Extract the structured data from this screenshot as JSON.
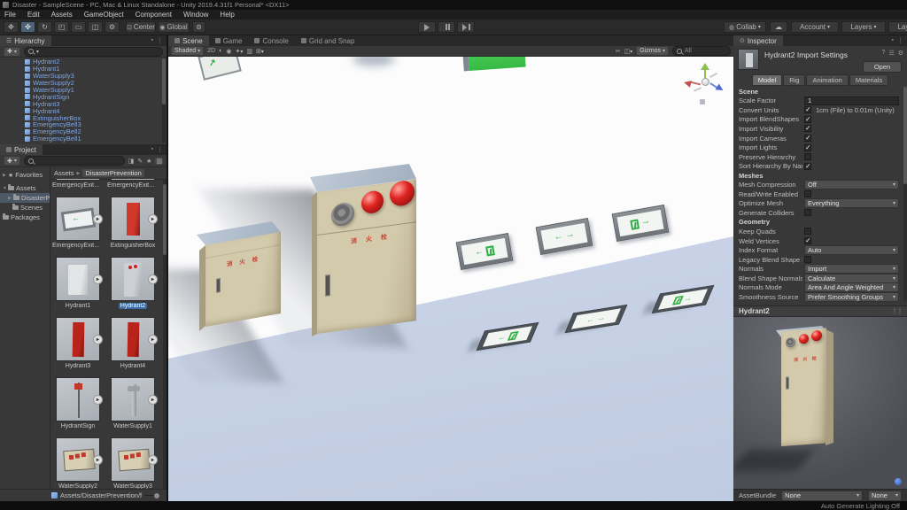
{
  "window": {
    "title": "Disaster - SampleScene - PC, Mac & Linux Standalone - Unity 2019.4.31f1 Personal* <DX11>",
    "menus": [
      "File",
      "Edit",
      "Assets",
      "GameObject",
      "Component",
      "Window",
      "Help"
    ]
  },
  "toolbar": {
    "center": "Center",
    "global": "Global",
    "collab": "Collab",
    "account": "Account",
    "layers": "Layers",
    "layout": "Layout"
  },
  "icons": {
    "unity-logo": "cube",
    "hand-tool": "✥",
    "move-tool": "✜",
    "rotate-tool": "↻",
    "scale-tool": "◰",
    "rect-tool": "▭",
    "transform-tool": "◫",
    "custom-tool": "⚙",
    "cloud-icon": "☁",
    "play-icon": "triangle",
    "pause-icon": "bars",
    "step-icon": "triangle-bar",
    "search-icon": "magnifier",
    "plus-icon": "✚",
    "dropdown-arrow": "▾",
    "kebab-icon": "⋮",
    "lock-icon": "▪",
    "star-icon": "★",
    "folder-icon": "folder-shape",
    "prefab-icon": "blue-cube",
    "expand-asset-icon": "►",
    "help-icon": "?",
    "gear-icon": "⚙",
    "preset-icon": "☰",
    "sphere-icon": "blue-dot"
  },
  "hierarchy": {
    "tab": "Hierarchy",
    "items": [
      "Hydrant2",
      "Hydrant1",
      "WaterSupply3",
      "WaterSupply2",
      "WaterSupply1",
      "HydrantSign",
      "Hydrant3",
      "Hydrant4",
      "ExtinguisherBox",
      "EmergencyBell3",
      "EmergencyBell2",
      "EmergencyBell1"
    ]
  },
  "project": {
    "tab": "Project",
    "favorites": "Favorites",
    "tree": {
      "assets": "Assets",
      "disasterprevention": "DisasterPrevention",
      "scenes": "Scenes",
      "packages": "Packages"
    },
    "breadcrumb_root": "Assets",
    "breadcrumb_current": "DisasterPrevention",
    "items": [
      {
        "label": "EmergencyExitSi...",
        "kind": "exitsign"
      },
      {
        "label": "EmergencyExitSi...",
        "kind": "exitsign"
      },
      {
        "label": "EmergencyExitSi...",
        "kind": "exitsign"
      },
      {
        "label": "ExtinguisherBox",
        "kind": "red-box"
      },
      {
        "label": "Hydrant1",
        "kind": "white-box"
      },
      {
        "label": "Hydrant2",
        "kind": "gray-box",
        "selected": true
      },
      {
        "label": "Hydrant3",
        "kind": "red-tall"
      },
      {
        "label": "Hydrant4",
        "kind": "red-tall"
      },
      {
        "label": "HydrantSign",
        "kind": "pole"
      },
      {
        "label": "WaterSupply1",
        "kind": "pipe"
      },
      {
        "label": "WaterSupply2",
        "kind": "panel"
      },
      {
        "label": "WaterSupply3",
        "kind": "panel"
      }
    ],
    "path": "Assets/DisasterPrevention/f"
  },
  "scene_view": {
    "tabs": [
      "Scene",
      "Game",
      "Console",
      "Grid and Snap"
    ],
    "active_tab": 0,
    "shading": "Shaded",
    "toggle_2d": "2D",
    "gizmos": "Gizmos",
    "search": "All",
    "cabinet_text": "消 火 栓"
  },
  "inspector": {
    "tab": "Inspector",
    "title": "Hydrant2 Import Settings",
    "open": "Open",
    "tabs": [
      "Model",
      "Rig",
      "Animation",
      "Materials"
    ],
    "active_tab": 0,
    "rows": [
      {
        "t": "h",
        "label": "Scene"
      },
      {
        "t": "i",
        "label": "Scale Factor",
        "value": "1"
      },
      {
        "t": "c",
        "label": "Convert Units",
        "checked": true,
        "note": "1cm (File) to 0.01m (Unity)"
      },
      {
        "t": "c",
        "label": "Import BlendShapes",
        "checked": true
      },
      {
        "t": "c",
        "label": "Import Visibility",
        "checked": true
      },
      {
        "t": "c",
        "label": "Import Cameras",
        "checked": true
      },
      {
        "t": "c",
        "label": "Import Lights",
        "checked": true
      },
      {
        "t": "c",
        "label": "Preserve Hierarchy",
        "checked": false
      },
      {
        "t": "c",
        "label": "Sort Hierarchy By Nam",
        "checked": true
      },
      {
        "t": "h",
        "label": "Meshes"
      },
      {
        "t": "d",
        "label": "Mesh Compression",
        "value": "Off"
      },
      {
        "t": "c",
        "label": "Read/Write Enabled",
        "checked": false
      },
      {
        "t": "d",
        "label": "Optimize Mesh",
        "value": "Everything"
      },
      {
        "t": "c",
        "label": "Generate Colliders",
        "checked": false
      },
      {
        "t": "h",
        "label": "Geometry"
      },
      {
        "t": "c",
        "label": "Keep Quads",
        "checked": false
      },
      {
        "t": "c",
        "label": "Weld Vertices",
        "checked": true
      },
      {
        "t": "d",
        "label": "Index Format",
        "value": "Auto"
      },
      {
        "t": "c",
        "label": "Legacy Blend Shape N",
        "checked": false
      },
      {
        "t": "d",
        "label": "Normals",
        "value": "Import"
      },
      {
        "t": "d",
        "label": "Blend Shape Normals",
        "value": "Calculate"
      },
      {
        "t": "d",
        "label": "Normals Mode",
        "value": "Area And Angle Weighted"
      },
      {
        "t": "d",
        "label": "Smoothness Source",
        "value": "Prefer Smoothing Groups"
      }
    ],
    "preview_title": "Hydrant2",
    "assetbundle": {
      "label": "AssetBundle",
      "value1": "None",
      "value2": "None"
    }
  },
  "status_bar": {
    "right": "Auto Generate Lighting Off"
  }
}
